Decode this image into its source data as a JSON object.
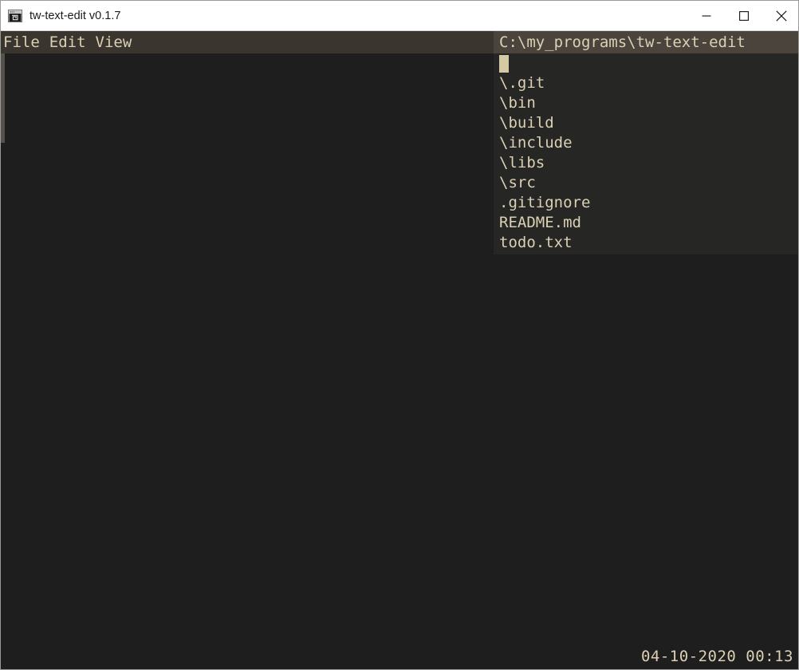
{
  "window": {
    "title": "tw-text-edit v0.1.7",
    "icon": "app-window-icon",
    "controls": {
      "minimize": "—",
      "maximize": "□",
      "close": "✕"
    },
    "colors": {
      "titlebar_bg": "#ffffff",
      "menubar_bg": "#3a352f",
      "editor_bg": "#1e1e1e",
      "panel_bg": "#262624",
      "path_header_bg": "#4a443c",
      "text": "#dbd0b4",
      "cursor": "#d5c9a6",
      "scrollbar_thumb": "#55524e"
    }
  },
  "menu": {
    "items": [
      {
        "label": "File"
      },
      {
        "label": "Edit"
      },
      {
        "label": "View"
      }
    ]
  },
  "file_panel": {
    "path": "C:\\my_programs\\tw-text-edit",
    "cursor_line": "",
    "entries": [
      {
        "name": "\\.git",
        "type": "directory"
      },
      {
        "name": "\\bin",
        "type": "directory"
      },
      {
        "name": "\\build",
        "type": "directory"
      },
      {
        "name": "\\include",
        "type": "directory"
      },
      {
        "name": "\\libs",
        "type": "directory"
      },
      {
        "name": "\\src",
        "type": "directory"
      },
      {
        "name": ".gitignore",
        "type": "file"
      },
      {
        "name": "README.md",
        "type": "file"
      },
      {
        "name": "todo.txt",
        "type": "file"
      }
    ]
  },
  "status": {
    "datetime": "04-10-2020 00:13"
  }
}
